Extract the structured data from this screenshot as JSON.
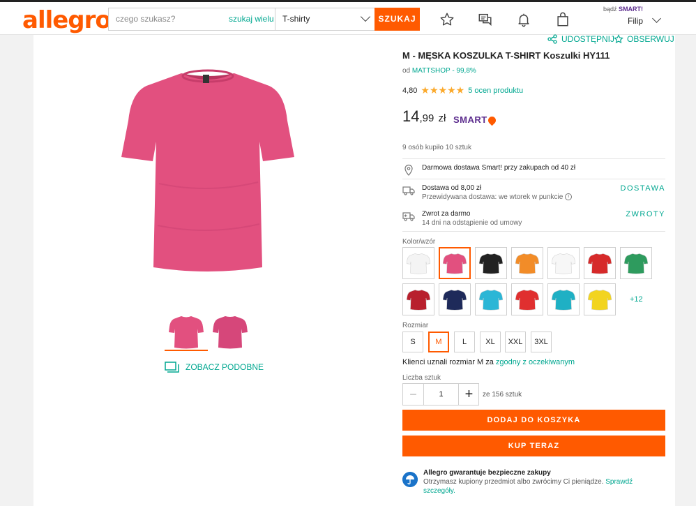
{
  "header": {
    "logo": "allegro",
    "search_placeholder": "czego szukasz?",
    "search_in_link": "szukaj wielu",
    "category": "T-shirty",
    "search_button": "SZUKAJ",
    "user_prefix": "bądź",
    "user_smart": "SMART!",
    "user_name": "Filip"
  },
  "gallery": {
    "similar_label": "ZOBACZ PODOBNE",
    "colors": {
      "shirt": "#e2507f",
      "shirt_dark": "#b8345f"
    }
  },
  "actions": {
    "share": "UDOSTĘPNIJ",
    "watch": "OBSERWUJ"
  },
  "product": {
    "title": "M - MĘSKA KOSZULKA T-SHIRT Koszulki HY111",
    "seller_prefix": "od",
    "seller": "MATTSHOP - 99,8%",
    "rating_value": "4,80",
    "stars": "★★★★★",
    "rating_count": "5 ocen produktu",
    "price_int": "14",
    "price_dec": ",99",
    "price_currency": "zł",
    "smart_label": "SMART",
    "bought": "9 osób kupiło 10 sztuk"
  },
  "delivery": {
    "free": "Darmowa dostawa Smart! przy zakupach od 40 zł",
    "from": "Dostawa od 8,00 zł",
    "estimate": "Przewidywana dostawa: we wtorek w punkcie",
    "delivery_link": "DOSTAWA",
    "return_title": "Zwrot za darmo",
    "return_sub": "14 dni na odstąpienie od umowy",
    "return_link": "ZWROTY"
  },
  "color_label": "Kolor/wzór",
  "colors_row1": [
    "#f4f4f4",
    "#e2507f",
    "#222222",
    "#f28c28",
    "#f7f7f7",
    "#d62a2a",
    "#2e9b5e"
  ],
  "colors_row2": [
    "#b8202d",
    "#1e2a5a",
    "#2bb6d6",
    "#e02f2f",
    "#1fb0c4",
    "#f2d41f"
  ],
  "colors_more": "+12",
  "size_label": "Rozmiar",
  "sizes": [
    "S",
    "M",
    "L",
    "XL",
    "XXL",
    "3XL"
  ],
  "fit_text": "Klienci uznali rozmiar M za",
  "fit_link": "zgodny z oczekiwanym",
  "qty_label": "Liczba sztuk",
  "qty_minus": "−",
  "qty_value": "1",
  "qty_plus": "+",
  "qty_of": "ze 156 sztuk",
  "add_to_cart": "DODAJ DO KOSZYKA",
  "buy_now": "KUP TERAZ",
  "guarantee": {
    "title": "Allegro gwarantuje bezpieczne zakupy",
    "text": "Otrzymasz kupiony przedmiot albo zwrócimy Ci pieniądze.",
    "link": "Sprawdź szczegóły."
  }
}
